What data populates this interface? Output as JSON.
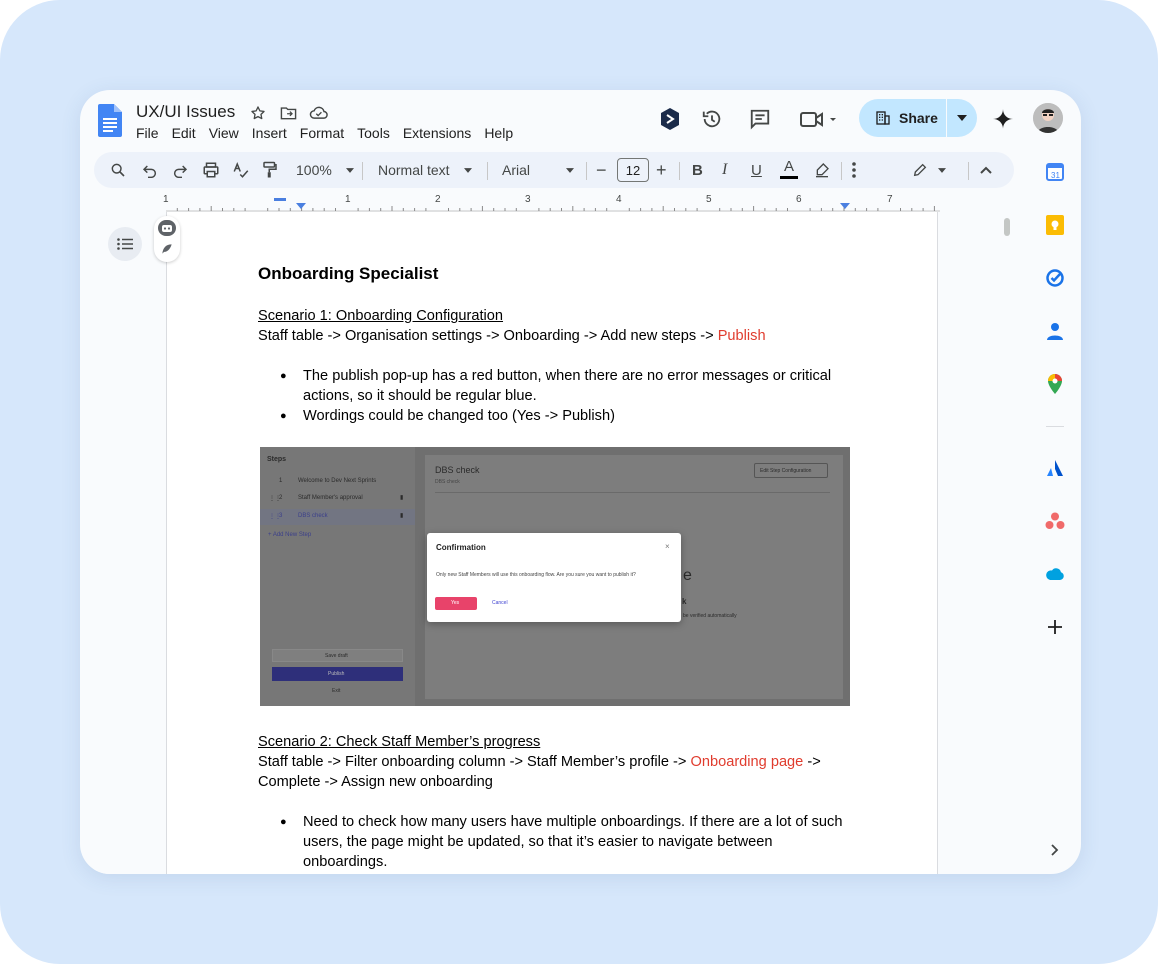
{
  "doc": {
    "title": "UX/UI Issues",
    "menu": [
      "File",
      "Edit",
      "View",
      "Insert",
      "Format",
      "Tools",
      "Extensions",
      "Help"
    ]
  },
  "header": {
    "share_label": "Share"
  },
  "toolbar": {
    "zoom": "100%",
    "style": "Normal text",
    "font": "Arial",
    "font_size": "12",
    "bold": "B",
    "italic": "I",
    "underline": "U",
    "text_color": "A",
    "minus": "−",
    "plus": "+"
  },
  "ruler": {
    "numbers": [
      "1",
      "1",
      "2",
      "3",
      "4",
      "5",
      "6",
      "7"
    ]
  },
  "content": {
    "heading": "Onboarding Specialist",
    "scenario1_title": "Scenario 1: Onboarding Configuration",
    "scenario1_path": "Staff table -> Organisation settings -> Onboarding -> Add new steps -> ",
    "scenario1_path_red": "Publish",
    "scenario1_bullets": [
      "The publish pop-up has a red button, when there are no error messages or critical actions, so it should be regular blue.",
      "Wordings could be changed too (Yes -> Publish)"
    ],
    "scenario2_title": "Scenario 2: Check Staff Member’s progress",
    "scenario2_path_a": "Staff table -> Filter onboarding column -> Staff Member’s profile -> ",
    "scenario2_path_red": "Onboarding page",
    "scenario2_path_b": " -> Complete -> Assign new onboarding",
    "scenario2_bullets": [
      "Need to check how many users have multiple onboardings. If there are a lot of such users, the page might be updated, so that it’s easier to navigate between onboardings."
    ]
  },
  "screenshot": {
    "steps_title": "Steps",
    "steps": [
      "Welcome to Dev Next Sprints",
      "Staff Member's approval",
      "DBS check"
    ],
    "step_numbers": [
      "1",
      "2",
      "3"
    ],
    "add_step": "+ Add New Step",
    "save_draft": "Save draft",
    "publish": "Publish",
    "exit": "Exit",
    "main_title": "DBS check",
    "main_sub": "DBS check",
    "edit_config": "Edit Step Configuration",
    "partial_e": "e",
    "partial_k": "k",
    "partial_auto": "be verified automatically",
    "dialog_title": "Confirmation",
    "dialog_close": "×",
    "dialog_body": "Only new Staff Members will use this onboarding flow. Are you sure you want to publish it?",
    "yes": "Yes",
    "cancel": "Cancel"
  },
  "colors": {
    "frame_bg": "#d6e7fb",
    "share_bg": "#c2e7ff",
    "toolbar_bg": "#edf2fa",
    "red_text": "#e03c2e",
    "dialog_yes": "#e8436a",
    "publish_btn": "#2e2f7a"
  }
}
